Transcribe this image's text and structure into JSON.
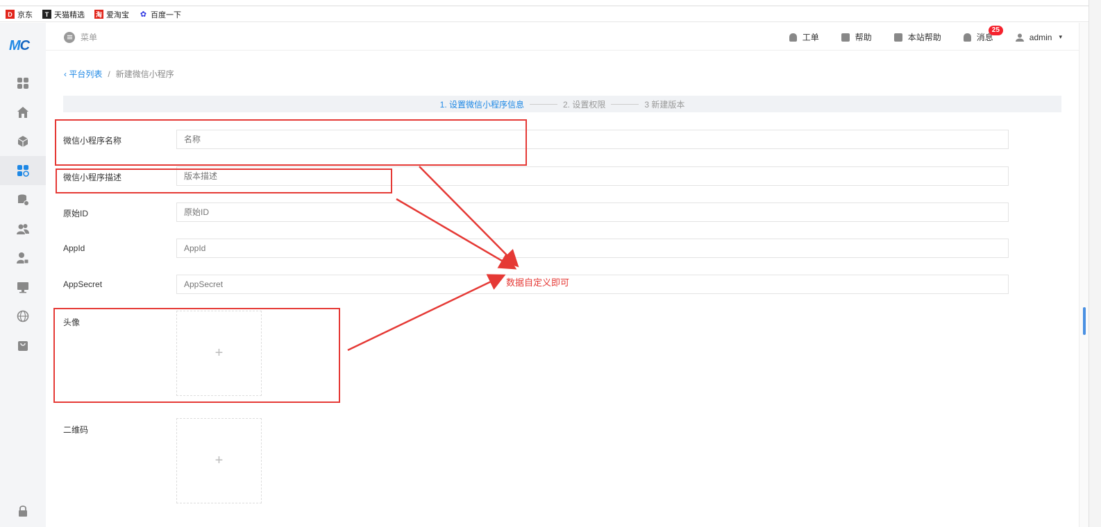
{
  "bookmarks": [
    {
      "label": "京东",
      "icon": "jd-icon",
      "color": "#e1251b",
      "glyph": "JD"
    },
    {
      "label": "天猫精选",
      "icon": "tmall-icon",
      "color": "#222222",
      "glyph": "T"
    },
    {
      "label": "爱淘宝",
      "icon": "taobao-icon",
      "color": "#e1251b",
      "glyph": "淘"
    },
    {
      "label": "百度一下",
      "icon": "baidu-icon",
      "color": "#2932e1",
      "glyph": "🐾"
    }
  ],
  "brand": {
    "logo": "MC",
    "color": "#1e88e5"
  },
  "header": {
    "menu_label": "菜单",
    "items": [
      {
        "label": "工单",
        "icon": "bell-icon"
      },
      {
        "label": "帮助",
        "icon": "bag-icon"
      },
      {
        "label": "本站帮助",
        "icon": "bag-icon"
      },
      {
        "label": "消息",
        "icon": "bell-icon",
        "badge": "25"
      }
    ],
    "user": "admin"
  },
  "breadcrumb": {
    "back": "平台列表",
    "separator": "/",
    "current": "新建微信小程序"
  },
  "steps": [
    "1. 设置微信小程序信息",
    "2. 设置权限",
    "3 新建版本"
  ],
  "form": {
    "name": {
      "label": "微信小程序名称",
      "placeholder": "名称"
    },
    "desc": {
      "label": "微信小程序描述",
      "placeholder": "版本描述"
    },
    "original_id": {
      "label": "原始ID",
      "placeholder": "原始ID"
    },
    "appid": {
      "label": "AppId",
      "placeholder": "AppId"
    },
    "appsecret": {
      "label": "AppSecret",
      "placeholder": "AppSecret"
    },
    "avatar": {
      "label": "头像",
      "plus": "+"
    },
    "qrcode": {
      "label": "二维码",
      "plus": "+"
    }
  },
  "annotation": {
    "text": "数据自定义即可",
    "color": "#e53935"
  },
  "colors": {
    "accent": "#1e88e5",
    "badge": "#f5222d"
  }
}
